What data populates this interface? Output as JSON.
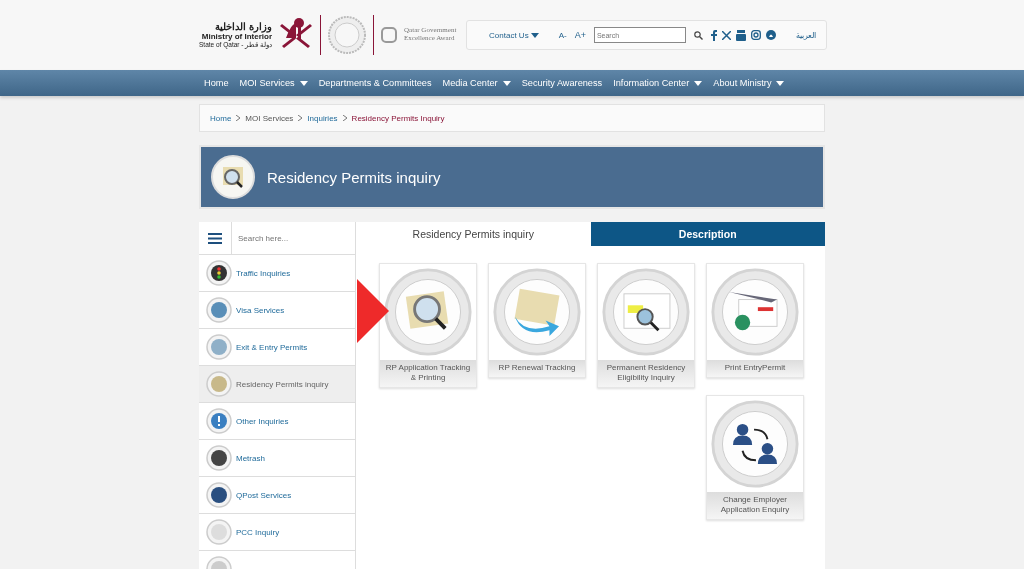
{
  "header": {
    "logo_arabic": "وزارة الداخلية",
    "logo_title": "Ministry of Interior",
    "logo_subtitle": "State of Qatar - دولة قطر",
    "award_text": "Qatar Government Excellence Award",
    "contact": "Contact Us",
    "font_decrease": "A-",
    "font_increase": "A+",
    "search": {
      "placeholder": "Search"
    },
    "language": "العربية"
  },
  "nav": [
    {
      "label": "Home",
      "dropdown": false
    },
    {
      "label": "MOI Services",
      "dropdown": true
    },
    {
      "label": "Departments & Committees",
      "dropdown": false
    },
    {
      "label": "Media Center",
      "dropdown": true
    },
    {
      "label": "Security Awareness",
      "dropdown": false
    },
    {
      "label": "Information Center",
      "dropdown": true
    },
    {
      "label": "About Ministry",
      "dropdown": true
    }
  ],
  "breadcrumb": [
    {
      "label": "Home",
      "kind": "link"
    },
    {
      "label": "MOI Services",
      "kind": "plain"
    },
    {
      "label": "Inquiries",
      "kind": "link"
    },
    {
      "label": "Residency Permits Inquiry",
      "kind": "current"
    }
  ],
  "banner": {
    "title": "Residency Permits inquiry"
  },
  "sidebar": {
    "search": {
      "placeholder": "Search here..."
    },
    "items": [
      {
        "label": "Traffic Inquiries",
        "selected": false
      },
      {
        "label": "Visa Services",
        "selected": false
      },
      {
        "label": "Exit & Entry Permits",
        "selected": false
      },
      {
        "label": "Residency Permits inquiry",
        "selected": true
      },
      {
        "label": "Other Inquiries",
        "selected": false
      },
      {
        "label": "Metrash",
        "selected": false
      },
      {
        "label": "QPost Services",
        "selected": false
      },
      {
        "label": "PCC Inquiry",
        "selected": false
      }
    ]
  },
  "tabs": [
    {
      "label": "Residency Permits inquiry",
      "selected": true
    },
    {
      "label": "Description",
      "selected": false
    }
  ],
  "services": [
    {
      "label": "RP Application Tracking & Printing"
    },
    {
      "label": "RP Renewal Tracking"
    },
    {
      "label": "Permanent Residency Eligibility Inquiry"
    },
    {
      "label": "Print EntryPermit"
    },
    {
      "label": "Change Employer Application Enquiry"
    }
  ]
}
